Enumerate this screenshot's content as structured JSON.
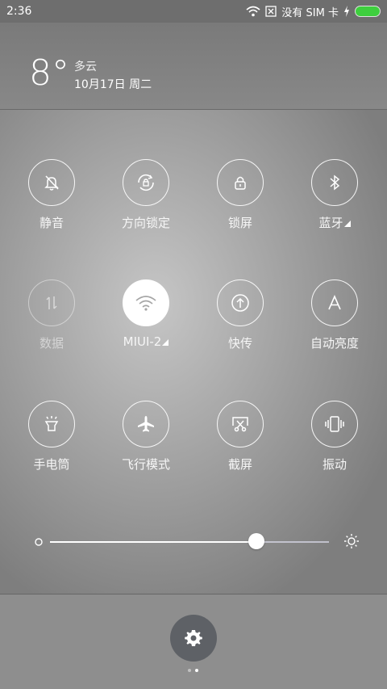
{
  "status_bar": {
    "time": "2:36",
    "no_sim": "没有 SIM 卡",
    "battery_color": "#3ecf3e"
  },
  "weather": {
    "temperature": "8°",
    "condition": "多云",
    "date": "10月17日 周二"
  },
  "toggles": [
    {
      "label": "静音",
      "icon": "bell-off-icon",
      "state": "off"
    },
    {
      "label": "方向锁定",
      "icon": "rotation-lock-icon",
      "state": "off"
    },
    {
      "label": "锁屏",
      "icon": "lock-icon",
      "state": "off"
    },
    {
      "label": "蓝牙",
      "icon": "bluetooth-icon",
      "state": "off",
      "expandable": true
    },
    {
      "label": "数据",
      "icon": "mobile-data-icon",
      "state": "disabled"
    },
    {
      "label": "MIUI-2",
      "icon": "wifi-icon",
      "state": "on",
      "expandable": true
    },
    {
      "label": "快传",
      "icon": "quick-send-icon",
      "state": "off"
    },
    {
      "label": "自动亮度",
      "icon": "auto-brightness-icon",
      "state": "off"
    },
    {
      "label": "手电筒",
      "icon": "flashlight-icon",
      "state": "off"
    },
    {
      "label": "飞行模式",
      "icon": "airplane-icon",
      "state": "off"
    },
    {
      "label": "截屏",
      "icon": "screenshot-icon",
      "state": "off"
    },
    {
      "label": "振动",
      "icon": "vibrate-icon",
      "state": "off"
    }
  ],
  "brightness": {
    "level": 0.74,
    "min_icon": "brightness-low-icon",
    "max_icon": "sun-icon"
  },
  "bottom": {
    "settings_icon": "gear-icon",
    "page_count": 2,
    "current_page": 2
  }
}
